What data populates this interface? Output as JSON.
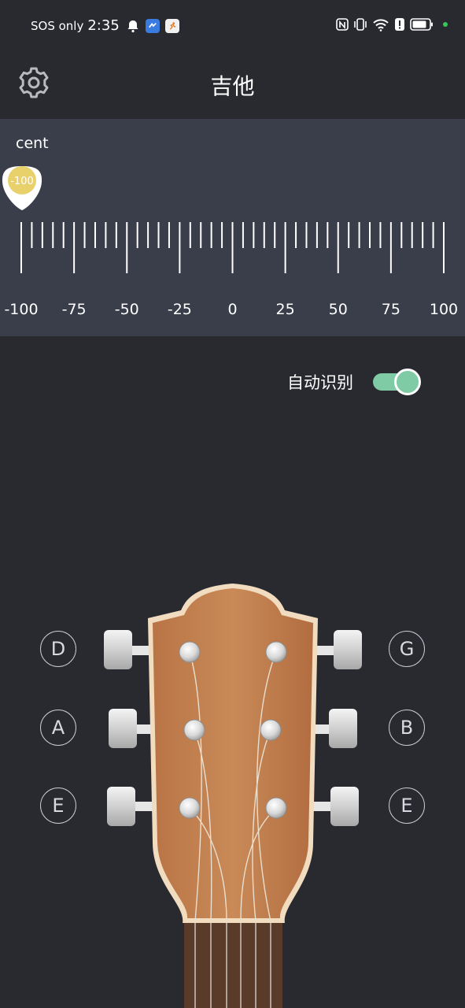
{
  "status_bar": {
    "carrier": "SOS only",
    "time": "2:35",
    "colors": {
      "app1": "#3a7be0",
      "app2": "#f0f0f0",
      "charging_dot": "#34c759"
    }
  },
  "header": {
    "title": "吉他",
    "settings_icon": "gear-icon"
  },
  "meter": {
    "unit": "cent",
    "indicator_value": "-100",
    "indicator_color": "#e8d16a",
    "tick_labels": [
      "-100",
      "-75",
      "-50",
      "-25",
      "0",
      "25",
      "50",
      "75",
      "100"
    ]
  },
  "auto_detect": {
    "label": "自动识别",
    "enabled": true,
    "accent_color": "#7ecba6"
  },
  "strings": {
    "left": [
      "D",
      "A",
      "E"
    ],
    "right": [
      "G",
      "B",
      "E"
    ]
  }
}
